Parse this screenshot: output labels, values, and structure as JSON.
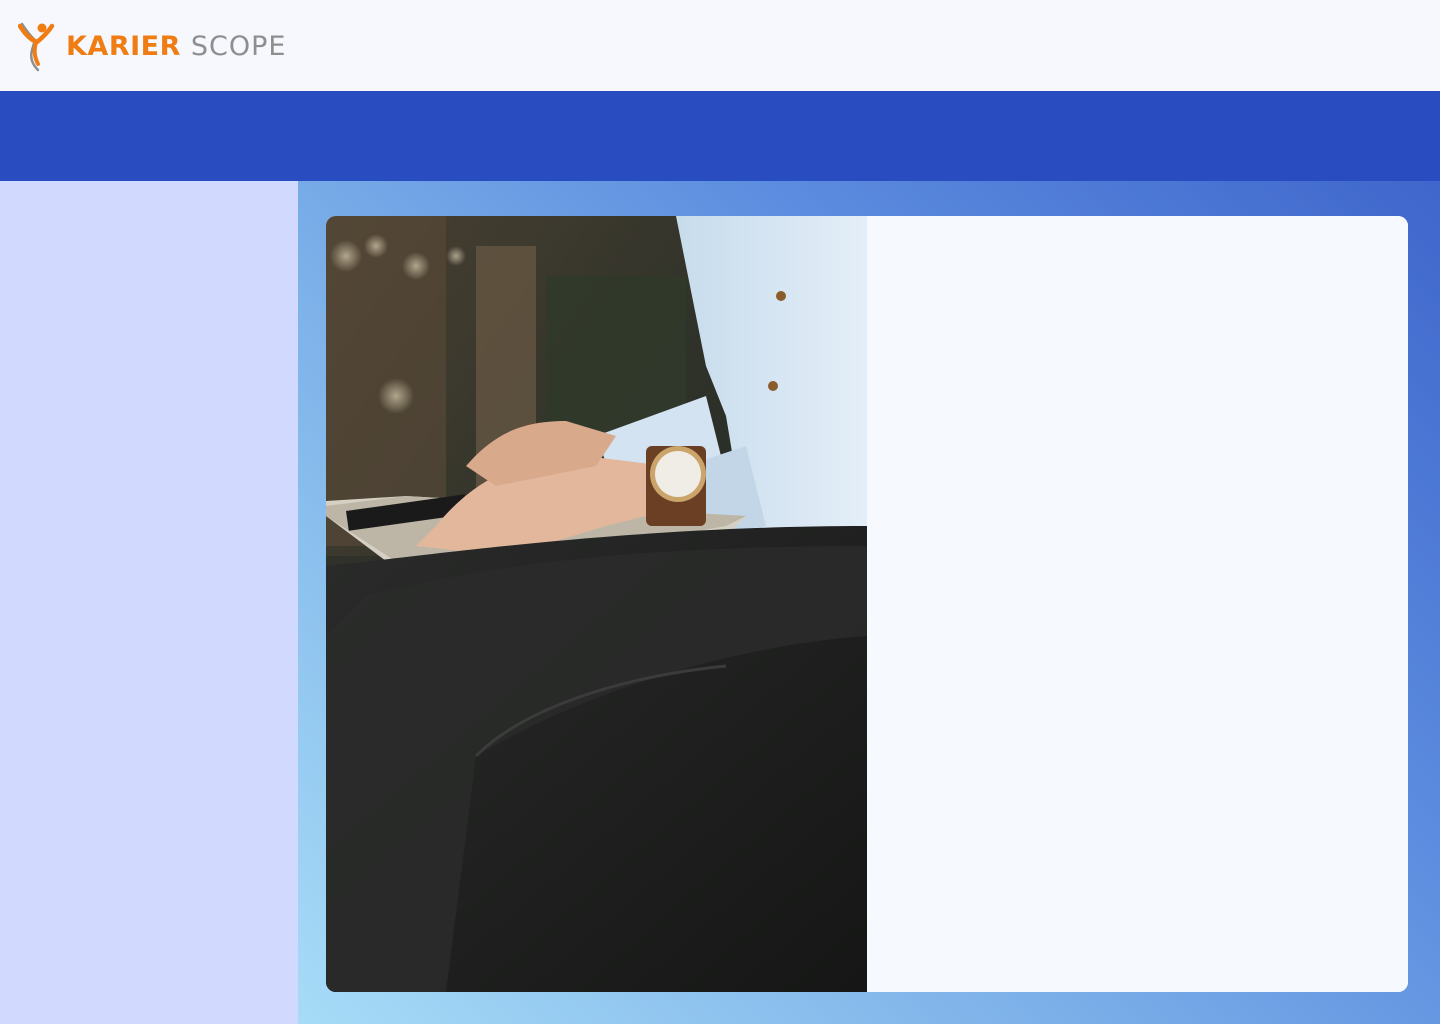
{
  "brand": {
    "name_part1": "KARIER",
    "name_part2": "SCOPE",
    "logo_icon": "person-leap-icon",
    "colors": {
      "orange": "#ef7d14",
      "gray": "#8e8e8e"
    }
  },
  "theme": {
    "header_bg": "#f6f8fe",
    "banner_bg": "#294dc1",
    "sidebar_bg": "#d2d9fe",
    "card_bg": "#f6f9fe",
    "gradient": [
      "#a7dcf7",
      "#7aaee8",
      "#5d8ee0",
      "#3f66cc"
    ]
  },
  "hero_image": {
    "icon": "laptop-person-photo"
  }
}
